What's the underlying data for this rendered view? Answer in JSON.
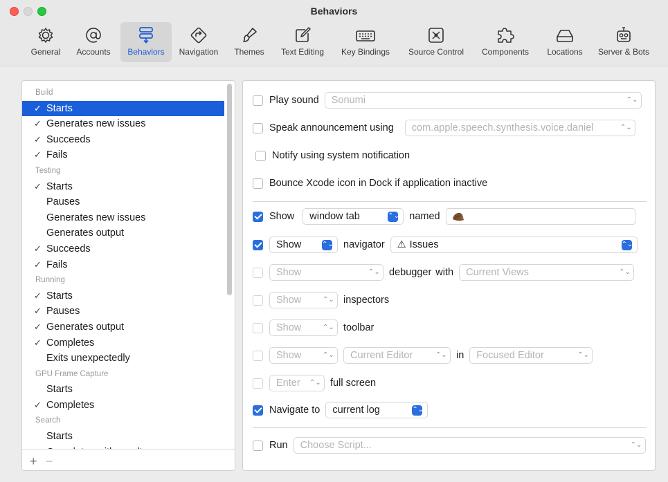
{
  "window": {
    "title": "Behaviors"
  },
  "toolbar": [
    {
      "label": "General",
      "icon": "gear-icon"
    },
    {
      "label": "Accounts",
      "icon": "at-sign-icon"
    },
    {
      "label": "Behaviors",
      "icon": "behaviors-icon",
      "selected": true
    },
    {
      "label": "Navigation",
      "icon": "navigation-arrow-icon"
    },
    {
      "label": "Themes",
      "icon": "paintbrush-icon"
    },
    {
      "label": "Text Editing",
      "icon": "pencil-square-icon"
    },
    {
      "label": "Key Bindings",
      "icon": "keyboard-icon"
    },
    {
      "label": "Source Control",
      "icon": "source-control-icon"
    },
    {
      "label": "Components",
      "icon": "puzzle-icon"
    },
    {
      "label": "Locations",
      "icon": "drive-icon"
    },
    {
      "label": "Server & Bots",
      "icon": "robot-icon"
    }
  ],
  "sidebar": {
    "rows": [
      {
        "type": "group",
        "label": "Build"
      },
      {
        "type": "item",
        "label": "Starts",
        "checked": true,
        "selected": true
      },
      {
        "type": "item",
        "label": "Generates new issues",
        "checked": true
      },
      {
        "type": "item",
        "label": "Succeeds",
        "checked": true
      },
      {
        "type": "item",
        "label": "Fails",
        "checked": true
      },
      {
        "type": "group",
        "label": "Testing"
      },
      {
        "type": "item",
        "label": "Starts",
        "checked": true
      },
      {
        "type": "item",
        "label": "Pauses",
        "checked": false
      },
      {
        "type": "item",
        "label": "Generates new issues",
        "checked": false
      },
      {
        "type": "item",
        "label": "Generates output",
        "checked": false
      },
      {
        "type": "item",
        "label": "Succeeds",
        "checked": true
      },
      {
        "type": "item",
        "label": "Fails",
        "checked": true
      },
      {
        "type": "group",
        "label": "Running"
      },
      {
        "type": "item",
        "label": "Starts",
        "checked": true
      },
      {
        "type": "item",
        "label": "Pauses",
        "checked": true
      },
      {
        "type": "item",
        "label": "Generates output",
        "checked": true
      },
      {
        "type": "item",
        "label": "Completes",
        "checked": true
      },
      {
        "type": "item",
        "label": "Exits unexpectedly",
        "checked": false
      },
      {
        "type": "group",
        "label": "GPU Frame Capture"
      },
      {
        "type": "item",
        "label": "Starts",
        "checked": false
      },
      {
        "type": "item",
        "label": "Completes",
        "checked": true
      },
      {
        "type": "group",
        "label": "Search"
      },
      {
        "type": "item",
        "label": "Starts",
        "checked": false
      },
      {
        "type": "item",
        "label": "Completes with results",
        "checked": false
      }
    ],
    "add_label": "+",
    "remove_label": "−",
    "check_glyph": "✓"
  },
  "options": {
    "play_sound": {
      "label": "Play sound",
      "checked": false,
      "value": "Sonumi"
    },
    "speak": {
      "label": "Speak announcement using",
      "checked": false,
      "value": "com.apple.speech.synthesis.voice.daniel"
    },
    "notify": {
      "label": "Notify using system notification",
      "checked": false
    },
    "bounce": {
      "label": "Bounce Xcode icon in Dock if application inactive",
      "checked": false
    },
    "show_tab": {
      "label": "Show",
      "checked": true,
      "value": "window tab",
      "named_label": "named"
    },
    "show_navigator": {
      "checked": true,
      "value": "Show",
      "label": "navigator",
      "target": "Issues",
      "target_icon": "warning-triangle-icon"
    },
    "show_debugger": {
      "checked": false,
      "value": "Show",
      "label": "debugger",
      "with_label": "with",
      "target": "Current Views"
    },
    "show_inspectors": {
      "checked": false,
      "value": "Show",
      "label": "inspectors"
    },
    "show_toolbar": {
      "checked": false,
      "value": "Show",
      "label": "toolbar"
    },
    "show_editor": {
      "checked": false,
      "value": "Show",
      "editor": "Current Editor",
      "in_label": "in",
      "target": "Focused Editor"
    },
    "full_screen": {
      "checked": false,
      "value": "Enter",
      "label": "full screen"
    },
    "navigate": {
      "label": "Navigate to",
      "checked": true,
      "value": "current log"
    },
    "run": {
      "label": "Run",
      "checked": false,
      "placeholder": "Choose Script..."
    }
  },
  "colors": {
    "accent": "#2a6ee0",
    "selection": "#1a5fd9"
  }
}
